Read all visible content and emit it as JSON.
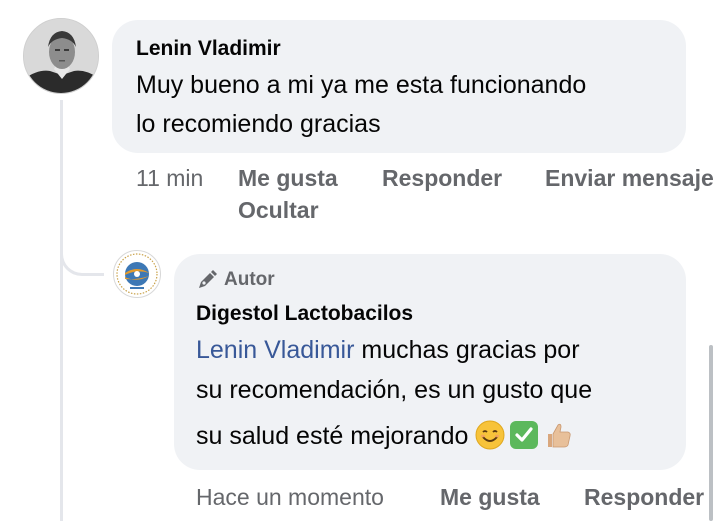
{
  "comment": {
    "author": "Lenin Vladimir",
    "text_line1": "Muy bueno a mi ya me esta funcionando",
    "text_line2": "lo recomiendo gracias",
    "time": "11 min",
    "actions": {
      "like": "Me gusta",
      "reply": "Responder",
      "send": "Enviar mensaje",
      "hide": "Ocultar"
    }
  },
  "reply": {
    "badge": "Autor",
    "badge_icon": "pen-icon",
    "author": "Digestol Lactobacilos",
    "mention": "Lenin Vladimir",
    "text_line1_rest": " muchas gracias por",
    "text_line2": "su recomendación, es un gusto que",
    "text_line3": "su salud esté mejorando ",
    "emojis": [
      "smiling-face-emoji",
      "check-mark-button-emoji",
      "thumbs-up-emoji"
    ],
    "time": "Hace un momento",
    "actions": {
      "like": "Me gusta",
      "reply": "Responder"
    }
  },
  "colors": {
    "bubble": "#f0f2f5",
    "meta_text": "#65676b",
    "mention": "#385898",
    "thread_line": "#e4e6eb"
  }
}
